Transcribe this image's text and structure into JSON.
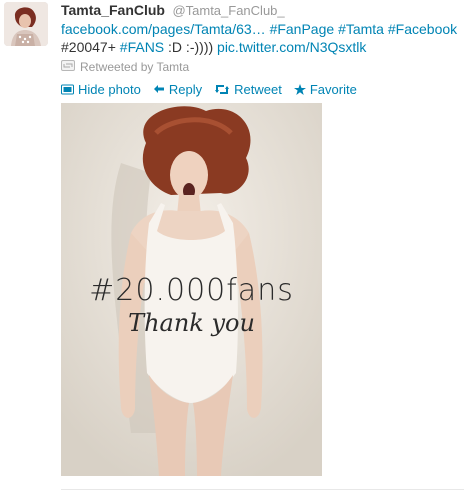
{
  "tweet": {
    "full_name": "Tamta_FanClub",
    "username": "@Tamta_FanClub_",
    "line1_link": "facebook.com/pages/Tamta/63…",
    "line1_tag1": "#FanPage",
    "line1_tag2": "#Tamta",
    "line1_tag3": "#Facebook",
    "line2_text1": "#20047+",
    "line2_tag": "#FANS",
    "line2_text2": ":D :-))))",
    "line2_link": "pic.twitter.com/N3Qsxtlk",
    "retweeted_by": "Retweeted by Tamta"
  },
  "actions": {
    "hide_photo": "Hide photo",
    "reply": "Reply",
    "retweet": "Retweet",
    "favorite": "Favorite"
  },
  "media": {
    "overlay_hashtag": "#20.000fans",
    "overlay_thanks": "Thank you"
  },
  "colors": {
    "link": "#0084b4",
    "muted": "#999999",
    "text": "#333333"
  }
}
